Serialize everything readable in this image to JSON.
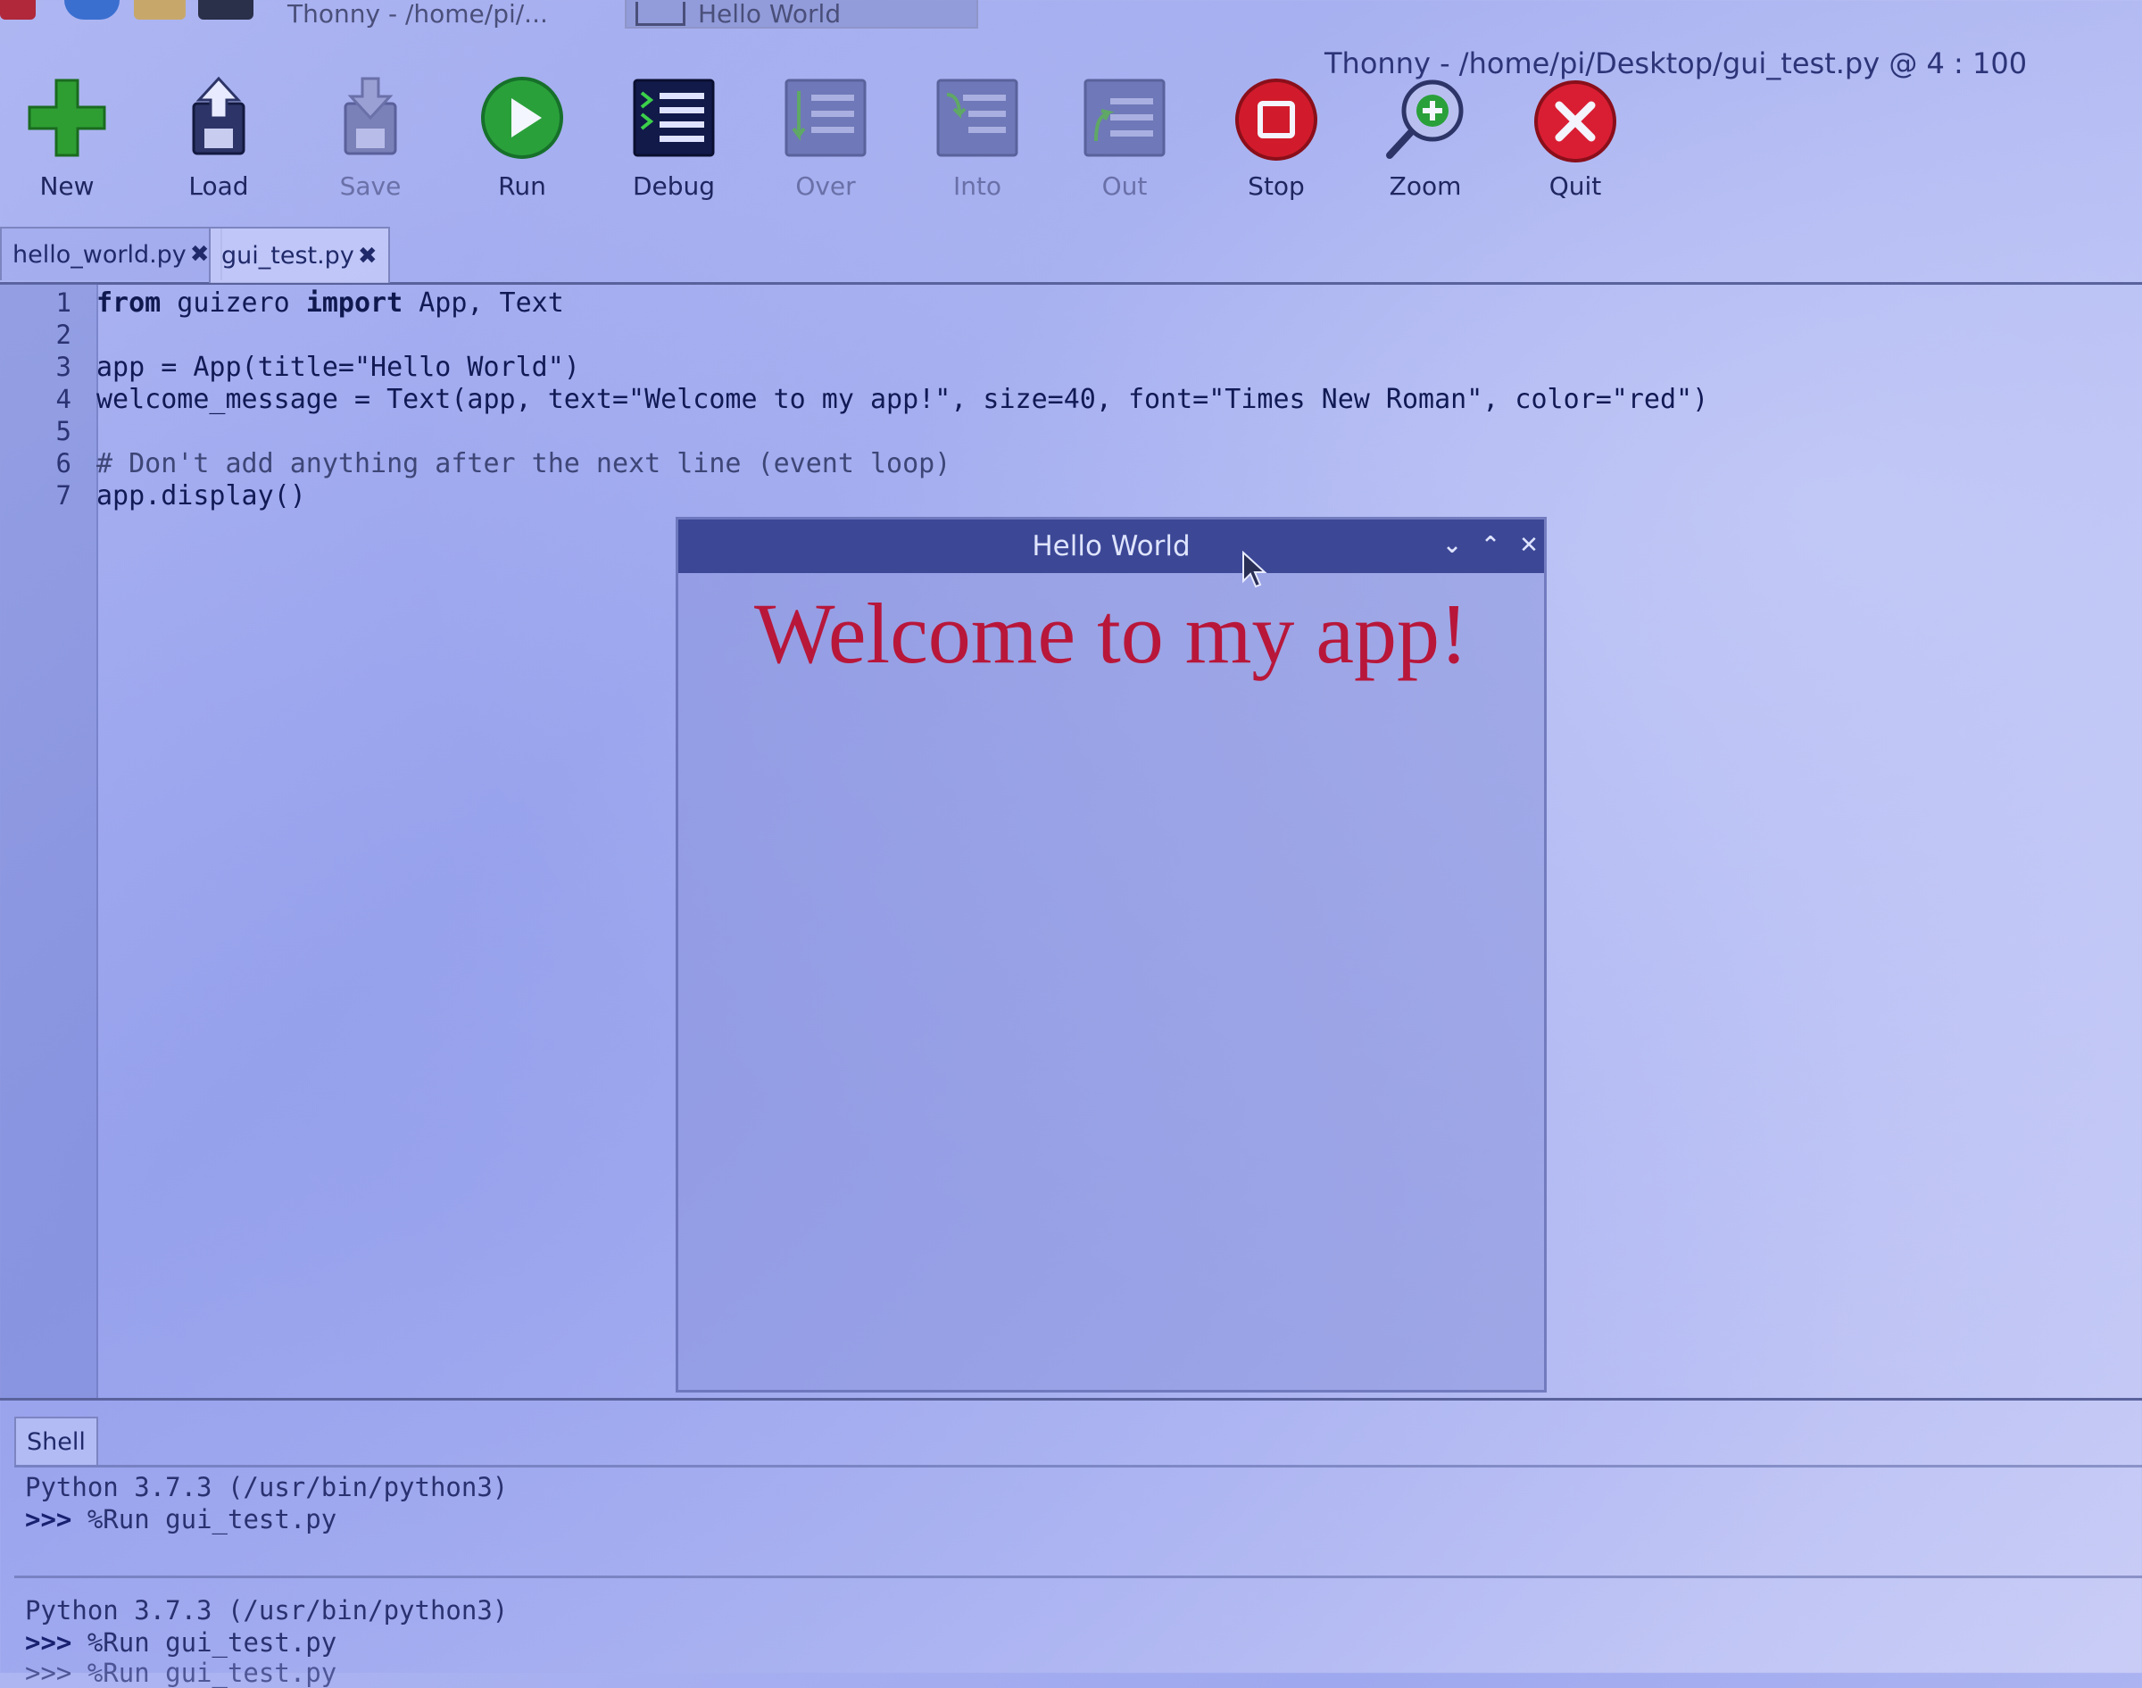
{
  "taskbar": {
    "tasks": [
      {
        "label": "Thonny  -  /home/pi/..."
      },
      {
        "label": "Hello World"
      }
    ]
  },
  "window": {
    "title": "Thonny  -  /home/pi/Desktop/gui_test.py  @  4 : 100"
  },
  "toolbar": {
    "buttons": [
      {
        "label": "New",
        "icon": "plus-icon",
        "enabled": true
      },
      {
        "label": "Load",
        "icon": "load-icon",
        "enabled": true
      },
      {
        "label": "Save",
        "icon": "save-icon",
        "enabled": false
      },
      {
        "label": "Run",
        "icon": "run-icon",
        "enabled": true
      },
      {
        "label": "Debug",
        "icon": "debug-icon",
        "enabled": true
      },
      {
        "label": "Over",
        "icon": "step-over-icon",
        "enabled": false
      },
      {
        "label": "Into",
        "icon": "step-into-icon",
        "enabled": false
      },
      {
        "label": "Out",
        "icon": "step-out-icon",
        "enabled": false
      },
      {
        "label": "Stop",
        "icon": "stop-icon",
        "enabled": true
      },
      {
        "label": "Zoom",
        "icon": "zoom-icon",
        "enabled": true
      },
      {
        "label": "Quit",
        "icon": "quit-icon",
        "enabled": true
      }
    ]
  },
  "tabs": [
    {
      "label": "hello_world.py",
      "close": "✖",
      "active": false
    },
    {
      "label": "gui_test.py",
      "close": "✖",
      "active": true
    }
  ],
  "editor": {
    "line_numbers": [
      "1",
      "2",
      "3",
      "4",
      "5",
      "6",
      "7"
    ],
    "lines": {
      "l1_kw1": "from",
      "l1_mod": " guizero ",
      "l1_kw2": "import",
      "l1_rest": " App, Text",
      "l3": "app = App(title=\"Hello World\")",
      "l4": "welcome_message = Text(app, text=\"Welcome to my app!\", size=40, font=\"Times New Roman\", color=\"red\")",
      "l6": "# Don't add anything after the next line (event loop)",
      "l7": "app.display()"
    }
  },
  "app_window": {
    "title": "Hello World",
    "minimize": "⌄",
    "maximize": "⌃",
    "close": "✕",
    "message": "Welcome to my app!",
    "message_color": "#b8173a"
  },
  "shell": {
    "tab_label": "Shell",
    "lines_1": {
      "version": "Python 3.7.3 (/usr/bin/python3)",
      "prompt": ">>>",
      "command": " %Run gui_test.py"
    },
    "lines_2": {
      "version": "Python 3.7.3 (/usr/bin/python3)",
      "prompt": ">>>",
      "command": " %Run gui_test.py",
      "partial": ">>> %Run gui_test.py"
    }
  },
  "colors": {
    "new_green": "#2e9e33",
    "run_green": "#2aa03a",
    "stop_red": "#d11b2c",
    "quit_red": "#d91e34",
    "titlebar": "#3c4896"
  }
}
